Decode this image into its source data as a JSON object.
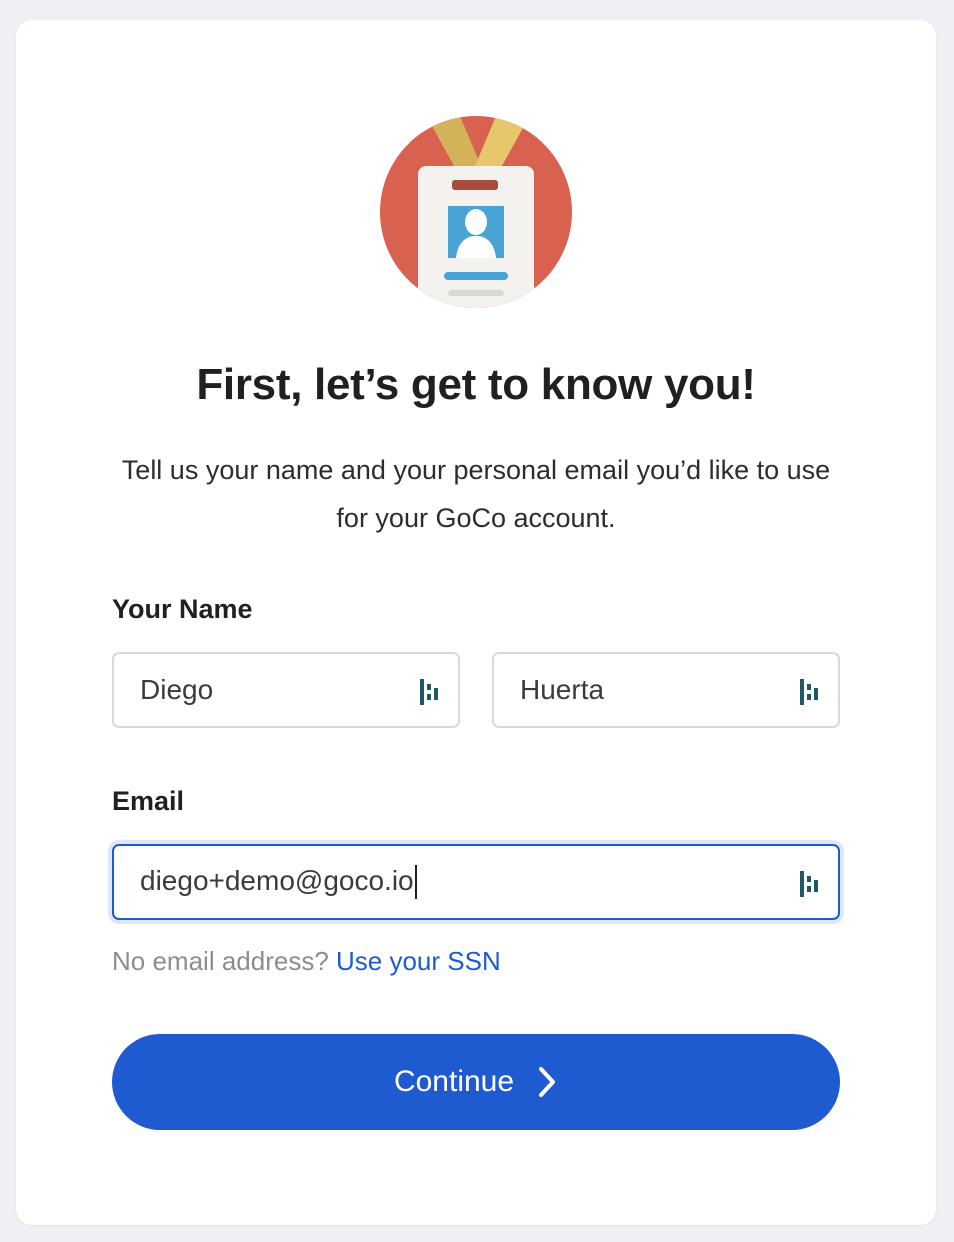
{
  "header": {
    "title": "First, let’s get to know you!",
    "subtitle": "Tell us your name and your personal email you’d like to use for your GoCo account."
  },
  "form": {
    "name_label": "Your Name",
    "first_name": {
      "value": "Diego"
    },
    "last_name": {
      "value": "Huerta"
    },
    "email_label": "Email",
    "email": {
      "value": "diego+demo@goco.io",
      "focused": true
    },
    "helper_text": "No email address?",
    "helper_link": "Use your SSN"
  },
  "actions": {
    "continue_label": "Continue"
  },
  "icons": {
    "hero": "id-badge-icon",
    "field_autofill": "dashlane-autofill-icon",
    "continue_arrow": "chevron-right-icon"
  },
  "colors": {
    "primary": "#1e5bd1",
    "background": "#eff0f3",
    "badge_circle": "#d96150",
    "lanyard": "#e6c46e",
    "avatar_blue": "#4aa3d5"
  }
}
